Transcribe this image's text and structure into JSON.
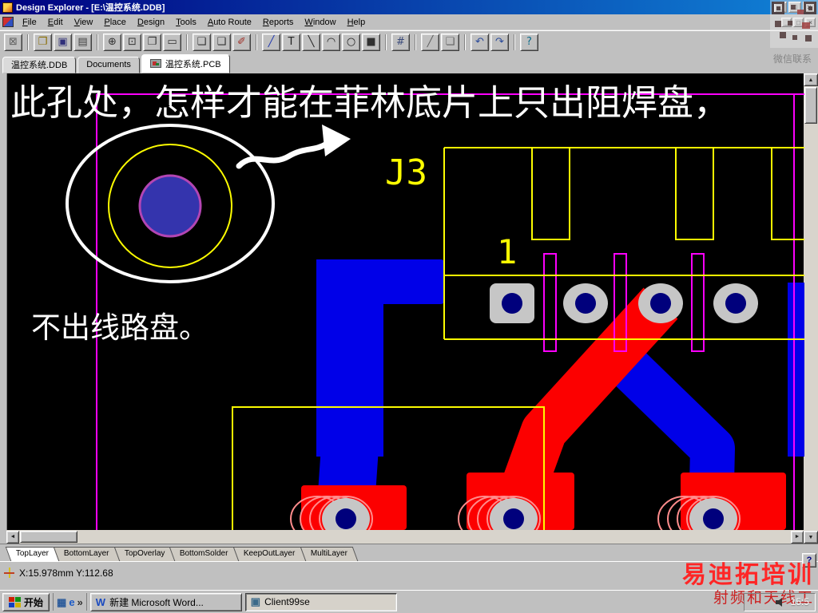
{
  "window": {
    "title": "Design Explorer - [E:\\温控系统.DDB]",
    "controls": {
      "minimize": "_",
      "maximize": "□",
      "close": "×"
    }
  },
  "menu": {
    "items": [
      {
        "label": "File",
        "accel": 0
      },
      {
        "label": "Edit",
        "accel": 0
      },
      {
        "label": "View",
        "accel": 0
      },
      {
        "label": "Place",
        "accel": 0
      },
      {
        "label": "Design",
        "accel": 0
      },
      {
        "label": "Tools",
        "accel": 0
      },
      {
        "label": "Auto Route",
        "accel": 0
      },
      {
        "label": "Reports",
        "accel": 0
      },
      {
        "label": "Window",
        "accel": 0
      },
      {
        "label": "Help",
        "accel": 0
      }
    ]
  },
  "toolbar": {
    "buttons": [
      {
        "name": "design-manager-button",
        "icon": "panels-toggle-icon",
        "glyph": "⊠",
        "color": "#606060"
      },
      {
        "sep": true
      },
      {
        "name": "open-button",
        "icon": "open-folder-icon",
        "glyph": "❐",
        "color": "#8a6d00"
      },
      {
        "name": "save-button",
        "icon": "floppy-icon",
        "glyph": "▣",
        "color": "#30307a"
      },
      {
        "name": "print-button",
        "icon": "printer-icon",
        "glyph": "▤",
        "color": "#404040"
      },
      {
        "sep": true
      },
      {
        "name": "zoom-in-button",
        "icon": "zoom-in-icon",
        "glyph": "⊕",
        "color": "#303030"
      },
      {
        "name": "zoom-area-button",
        "icon": "zoom-area-icon",
        "glyph": "⊡",
        "color": "#303030"
      },
      {
        "name": "zoom-page-button",
        "icon": "zoom-page-icon",
        "glyph": "❐",
        "color": "#303030"
      },
      {
        "name": "fit-board-button",
        "icon": "fit-board-icon",
        "glyph": "▭",
        "color": "#303030"
      },
      {
        "sep": true
      },
      {
        "name": "copy-button",
        "icon": "copy-icon",
        "glyph": "❏",
        "color": "#303030"
      },
      {
        "name": "paste-button",
        "icon": "paste-icon",
        "glyph": "❑",
        "color": "#303030"
      },
      {
        "name": "brush-button",
        "icon": "brush-icon",
        "glyph": "✐",
        "color": "#a03028"
      },
      {
        "sep": true
      },
      {
        "name": "wire-button",
        "icon": "wire-icon",
        "glyph": "╱",
        "color": "#2038b0"
      },
      {
        "name": "text-button",
        "icon": "text-icon",
        "glyph": "T",
        "color": "#202020"
      },
      {
        "name": "line-button",
        "icon": "line-icon",
        "glyph": "╲",
        "color": "#202020"
      },
      {
        "name": "arc-button",
        "icon": "arc-icon",
        "glyph": "◠",
        "color": "#202020"
      },
      {
        "name": "circle-button",
        "icon": "circle-icon",
        "glyph": "○",
        "color": "#202020"
      },
      {
        "name": "fill-button",
        "icon": "filled-rect-icon",
        "glyph": "■",
        "color": "#303030"
      },
      {
        "sep": true
      },
      {
        "name": "grid-button",
        "icon": "grid-icon",
        "glyph": "#",
        "color": "#3a4a7a"
      },
      {
        "sep": true
      },
      {
        "name": "measure-button",
        "icon": "measure-icon",
        "glyph": "╱",
        "color": "#606060"
      },
      {
        "name": "report-button",
        "icon": "sheet-icon",
        "glyph": "❏",
        "color": "#606060"
      },
      {
        "sep": true
      },
      {
        "name": "undo-button",
        "icon": "undo-icon",
        "glyph": "↶",
        "color": "#2a4a9a"
      },
      {
        "name": "redo-button",
        "icon": "redo-icon",
        "glyph": "↷",
        "color": "#2a4a9a"
      },
      {
        "sep": true
      },
      {
        "name": "help-button",
        "icon": "help-icon",
        "glyph": "?",
        "color": "#0a6a8a"
      }
    ]
  },
  "doc_tabs": [
    {
      "label": "温控系统.DDB"
    },
    {
      "label": "Documents"
    },
    {
      "label": "温控系统.PCB"
    }
  ],
  "pcb": {
    "labels": {
      "designator": "J3",
      "pin1": "1"
    },
    "annotations": {
      "line1": "此孔处，怎样才能在菲林底片上只出阻焊盘，",
      "line2": "不出线路盘。"
    },
    "colors": {
      "background": "#000000",
      "blue": "#0000e8",
      "red": "#fc0000",
      "yellow": "#fcfc00",
      "magenta": "#fc00fc",
      "pad": "#c6c6c6",
      "hole": "#00007c",
      "pink": "#ff8c8c",
      "white": "#ffffff",
      "viaFill": "#3434ad",
      "viaRing": "#b345b3"
    }
  },
  "layer_tabs": [
    "TopLayer",
    "BottomLayer",
    "TopOverlay",
    "BottomSolder",
    "KeepOutLayer",
    "MultiLayer"
  ],
  "status": {
    "coords": "X:15.978mm Y:112.68"
  },
  "taskbar": {
    "start_label": "开始",
    "quick_launch": [
      {
        "name": "show-desktop-icon",
        "glyph": "▦",
        "color": "#2a5a9a"
      },
      {
        "name": "ie-icon",
        "glyph": "e",
        "color": "#1a5ac8"
      },
      {
        "name": "chevron-icon",
        "glyph": "»",
        "color": "#303030"
      }
    ],
    "tasks": [
      {
        "label": "新建 Microsoft Word...",
        "icon_glyph": "W",
        "icon_color": "#1a4ac0",
        "pressed": false
      },
      {
        "label": "Client99se",
        "icon_glyph": "▣",
        "icon_color": "#3a6a8a",
        "pressed": true
      }
    ],
    "tray_time": "15:5"
  },
  "watermarks": {
    "qr_caption": "微信联系",
    "brand_line1": "易迪拓培训",
    "brand_line2": "射频和天线工"
  },
  "editor_help_label": "?"
}
